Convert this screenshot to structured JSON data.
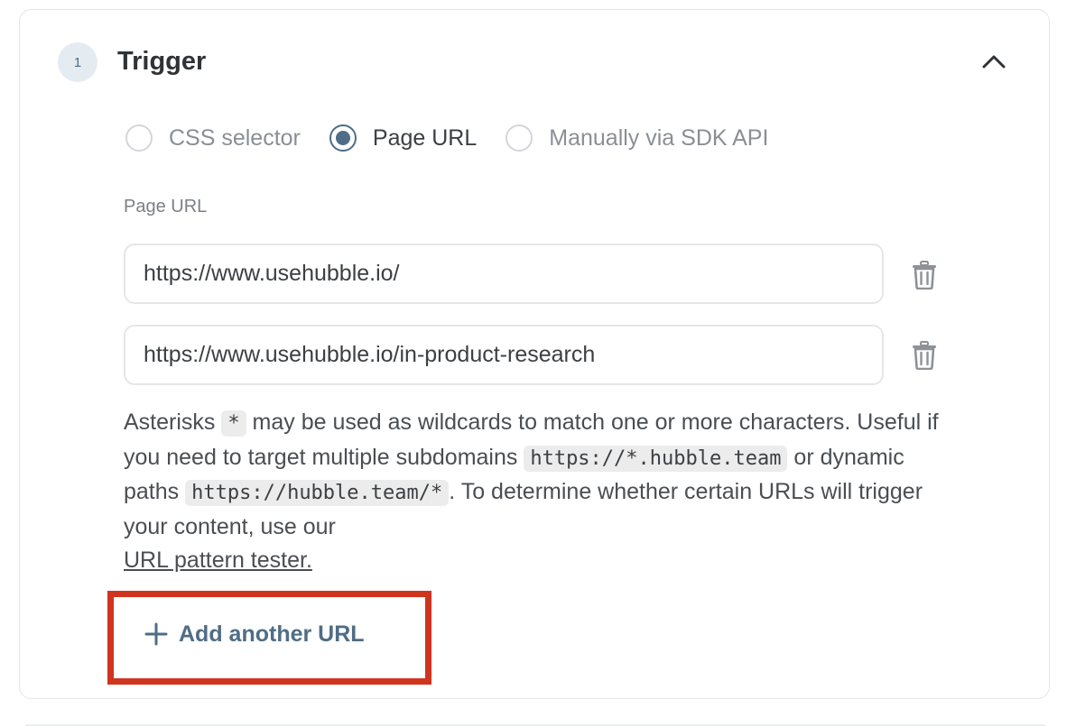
{
  "step": {
    "number": "1",
    "title": "Trigger"
  },
  "trigger_options": [
    {
      "label": "CSS selector",
      "checked": false
    },
    {
      "label": "Page URL",
      "checked": true
    },
    {
      "label": "Manually via SDK API",
      "checked": false
    }
  ],
  "page_url": {
    "label": "Page URL",
    "urls": [
      "https://www.usehubble.io/",
      "https://www.usehubble.io/in-product-research"
    ]
  },
  "help": {
    "part1": "Asterisks ",
    "code_asterisk": "*",
    "part2": " may be used as wildcards to match one or more characters. Useful if you need to target multiple subdomains ",
    "code_subdomain": "https://*.hubble.team",
    "part3": " or dynamic paths ",
    "code_path": "https://hubble.team/*",
    "part4": ". To determine whether certain URLs will trigger your content, use our ",
    "link_text": "URL pattern tester."
  },
  "add_button": {
    "label": "Add another URL"
  },
  "icons": {
    "collapse": "chevron-up-icon",
    "delete": "trash-icon",
    "add": "plus-icon"
  },
  "colors": {
    "accent": "#4f6d86",
    "badge_bg": "#e4ecf2",
    "highlight_box": "#d0341f",
    "code_bg": "#ececec"
  }
}
